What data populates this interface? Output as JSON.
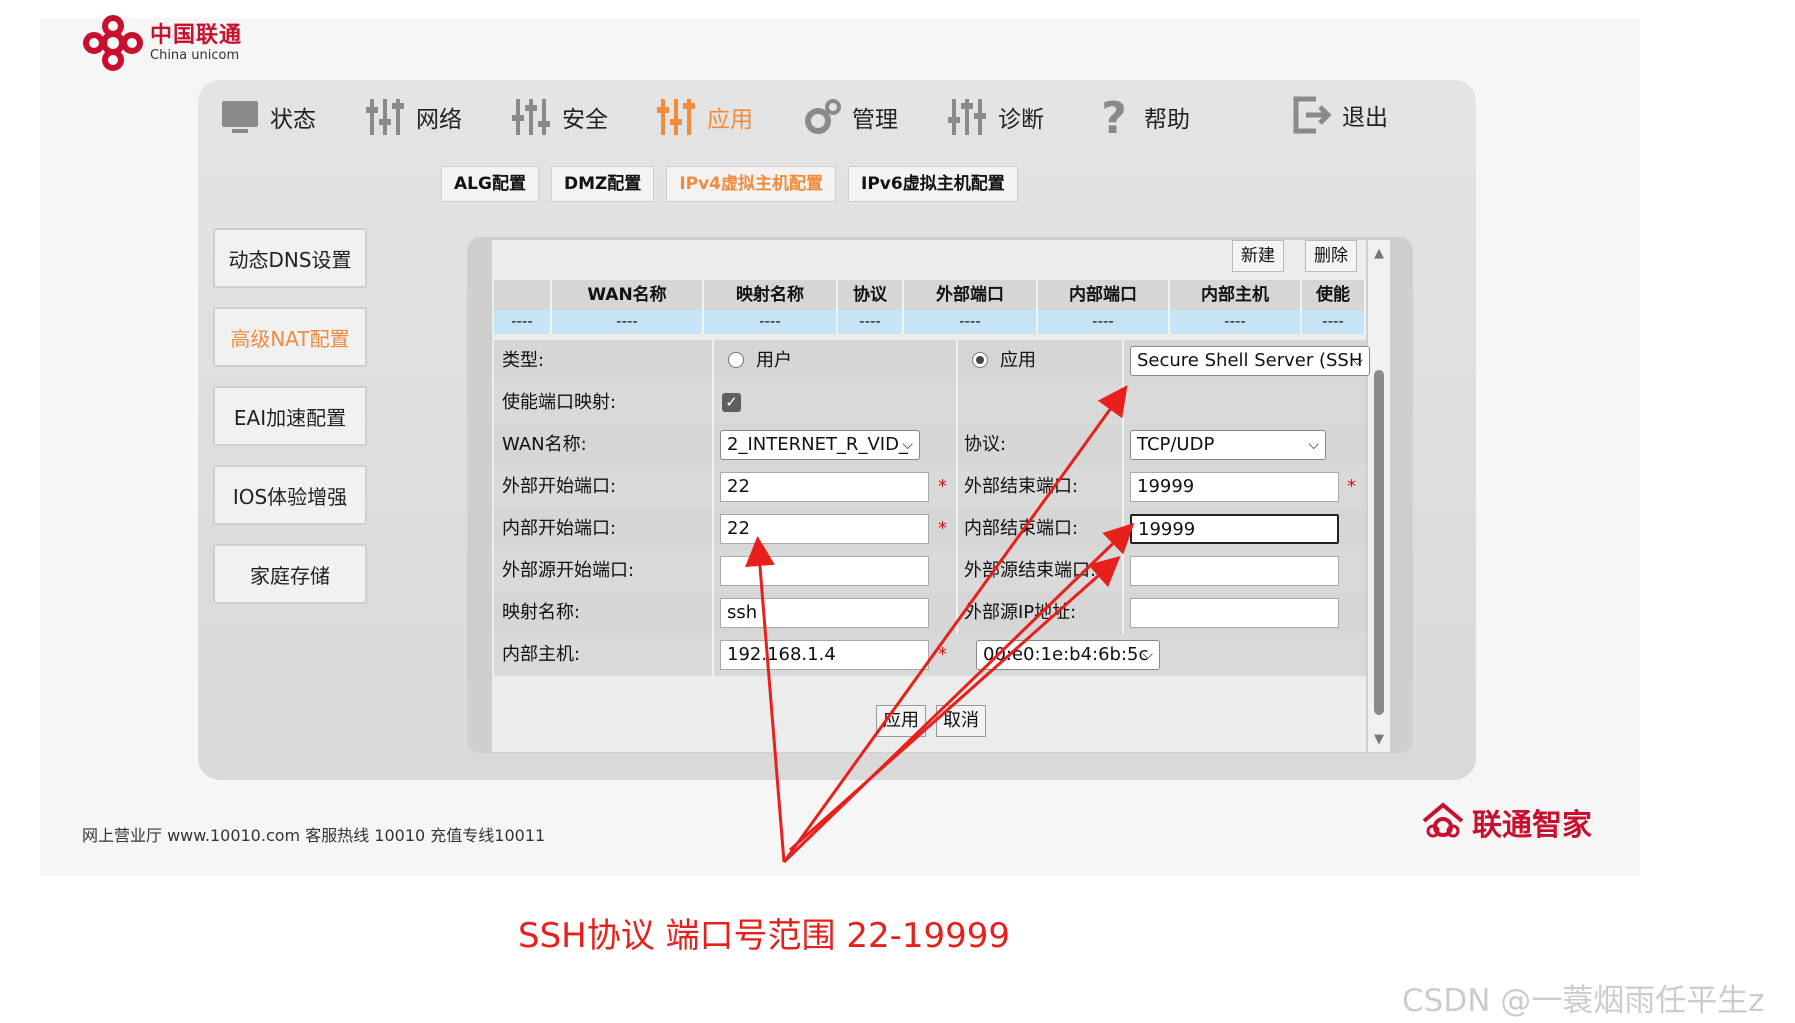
{
  "brand": {
    "cn": "中国联通",
    "en": "China unicom"
  },
  "nav": {
    "items": [
      {
        "label": "状态",
        "icon": "monitor-icon"
      },
      {
        "label": "网络",
        "icon": "sliders-icon"
      },
      {
        "label": "安全",
        "icon": "sliders-icon"
      },
      {
        "label": "应用",
        "icon": "sliders-icon",
        "active": true
      },
      {
        "label": "管理",
        "icon": "gear-icon"
      },
      {
        "label": "诊断",
        "icon": "sliders-icon"
      },
      {
        "label": "帮助",
        "icon": "question-icon"
      },
      {
        "label": "退出",
        "icon": "logout-icon"
      }
    ]
  },
  "subnav": {
    "items": [
      {
        "label": "ALG配置"
      },
      {
        "label": "DMZ配置"
      },
      {
        "label": "IPv4虚拟主机配置",
        "active": true
      },
      {
        "label": "IPv6虚拟主机配置"
      }
    ]
  },
  "sidebar": {
    "items": [
      {
        "label": "动态DNS设置"
      },
      {
        "label": "高级NAT配置",
        "active": true
      },
      {
        "label": "EAI加速配置"
      },
      {
        "label": "IOS体验增强"
      },
      {
        "label": "家庭存储"
      }
    ]
  },
  "toolbar": {
    "new_label": "新建",
    "delete_label": "删除"
  },
  "table": {
    "columns": [
      "",
      "WAN名称",
      "映射名称",
      "协议",
      "外部端口",
      "内部端口",
      "内部主机",
      "使能"
    ],
    "rows": [
      [
        "----",
        "----",
        "----",
        "----",
        "----",
        "----",
        "----",
        "----"
      ]
    ]
  },
  "form": {
    "type_label": "类型:",
    "type_option_user": "用户",
    "type_option_app": "应用",
    "type_selected": "应用",
    "app_select_value": "Secure Shell Server (SSH",
    "enable_label": "使能端口映射:",
    "enable_checked": true,
    "wan_label": "WAN名称:",
    "wan_value": "2_INTERNET_R_VID_",
    "protocol_label": "协议:",
    "protocol_value": "TCP/UDP",
    "ext_start_label": "外部开始端口:",
    "ext_start_value": "22",
    "ext_end_label": "外部结束端口:",
    "ext_end_value": "19999",
    "int_start_label": "内部开始端口:",
    "int_start_value": "22",
    "int_end_label": "内部结束端口:",
    "int_end_value": "19999",
    "src_start_label": "外部源开始端口:",
    "src_start_value": "",
    "src_end_label": "外部源结束端口:",
    "src_end_value": "",
    "map_name_label": "映射名称:",
    "map_name_value": "ssh",
    "src_ip_label": "外部源IP地址:",
    "src_ip_value": "",
    "int_host_label": "内部主机:",
    "int_host_value": "192.168.1.4",
    "mac_value": "00:e0:1e:b4:6b:5c",
    "required_mark": "*"
  },
  "actions": {
    "apply_label": "应用",
    "cancel_label": "取消"
  },
  "footer": {
    "info": "网上营业厅 www.10010.com  客服热线  10010  充值专线10011",
    "brand": "联通智家"
  },
  "annotation": {
    "caption": "SSH协议 端口号范围 22-19999",
    "color": "#e8201c"
  },
  "watermark": "CSDN @一蓑烟雨任平生z"
}
